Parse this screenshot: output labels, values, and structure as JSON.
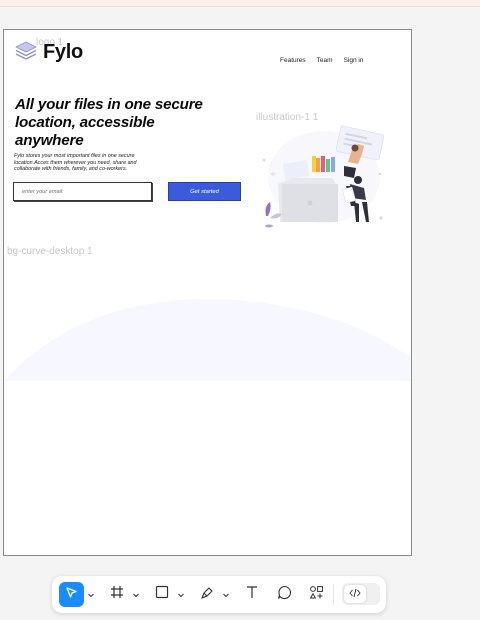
{
  "frame": {
    "layers": {
      "logo": "logo 1",
      "illustration": "illustration-1 1",
      "background": "bg-curve-desktop 1"
    },
    "header": {
      "logo_text": "Fylo",
      "nav": [
        "Features",
        "Team",
        "Sign in"
      ]
    },
    "hero": {
      "title": "All your files in one secure location, accessible anywhere",
      "subtitle": "Fylo stores your most important files in one secure location.Acces them wherever you need, share and collaborate with friends, family, and co-workers.",
      "email_placeholder": "enter your email:",
      "cta_label": "Get started"
    }
  },
  "toolbar": {
    "tools": [
      "move-tool",
      "frame-tool",
      "shape-tool",
      "pen-tool",
      "text-tool",
      "comment-tool",
      "actions-tool"
    ],
    "active_tool": "move-tool",
    "code_toggle": "dev-mode"
  },
  "colors": {
    "canvas_bg": "#f4f4f4",
    "cta": "#3b5bdb",
    "active_tool": "#1a8cff",
    "curve": "#f7f7ff",
    "layer_label": "#c7c7cf"
  }
}
